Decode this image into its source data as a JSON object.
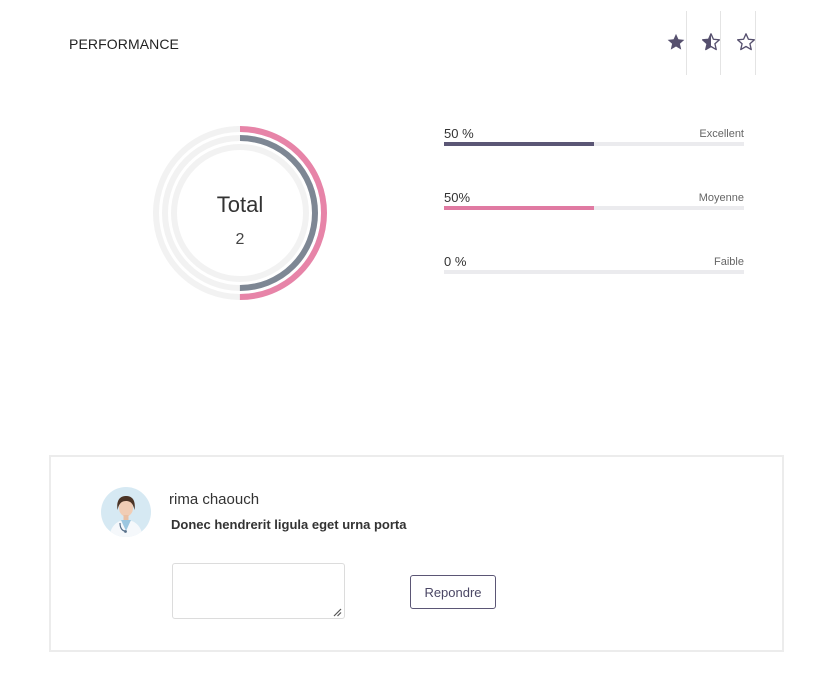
{
  "header": {
    "title": "PERFORMANCE"
  },
  "star_tabs": [
    {
      "icon": "star-full-icon"
    },
    {
      "icon": "star-half-icon"
    },
    {
      "icon": "star-empty-icon"
    }
  ],
  "donut": {
    "total_label": "Total",
    "total_value": "2",
    "rings": [
      {
        "name": "excellent",
        "fraction": 0.5,
        "color": "#e784a8"
      },
      {
        "name": "moyenne",
        "fraction": 0.5,
        "color": "#7e8794"
      },
      {
        "name": "faible",
        "fraction": 0.0,
        "color": "#f2f2f2"
      }
    ]
  },
  "stats": [
    {
      "percent_text": "50 %",
      "label": "Excellent",
      "fraction": 0.5,
      "color": "#5b5675"
    },
    {
      "percent_text": "50%",
      "label": "Moyenne",
      "fraction": 0.5,
      "color": "#e07aa2"
    },
    {
      "percent_text": "0 %",
      "label": "Faible",
      "fraction": 0.0,
      "color": "#e07aa2"
    }
  ],
  "comment": {
    "author": "rima chaouch",
    "text": "Donec hendrerit ligula eget urna porta",
    "reply_value": "",
    "reply_button": "Repondre"
  },
  "colors": {
    "primary": "#5b5675",
    "accent": "#e07aa2",
    "track": "#ebebee"
  }
}
